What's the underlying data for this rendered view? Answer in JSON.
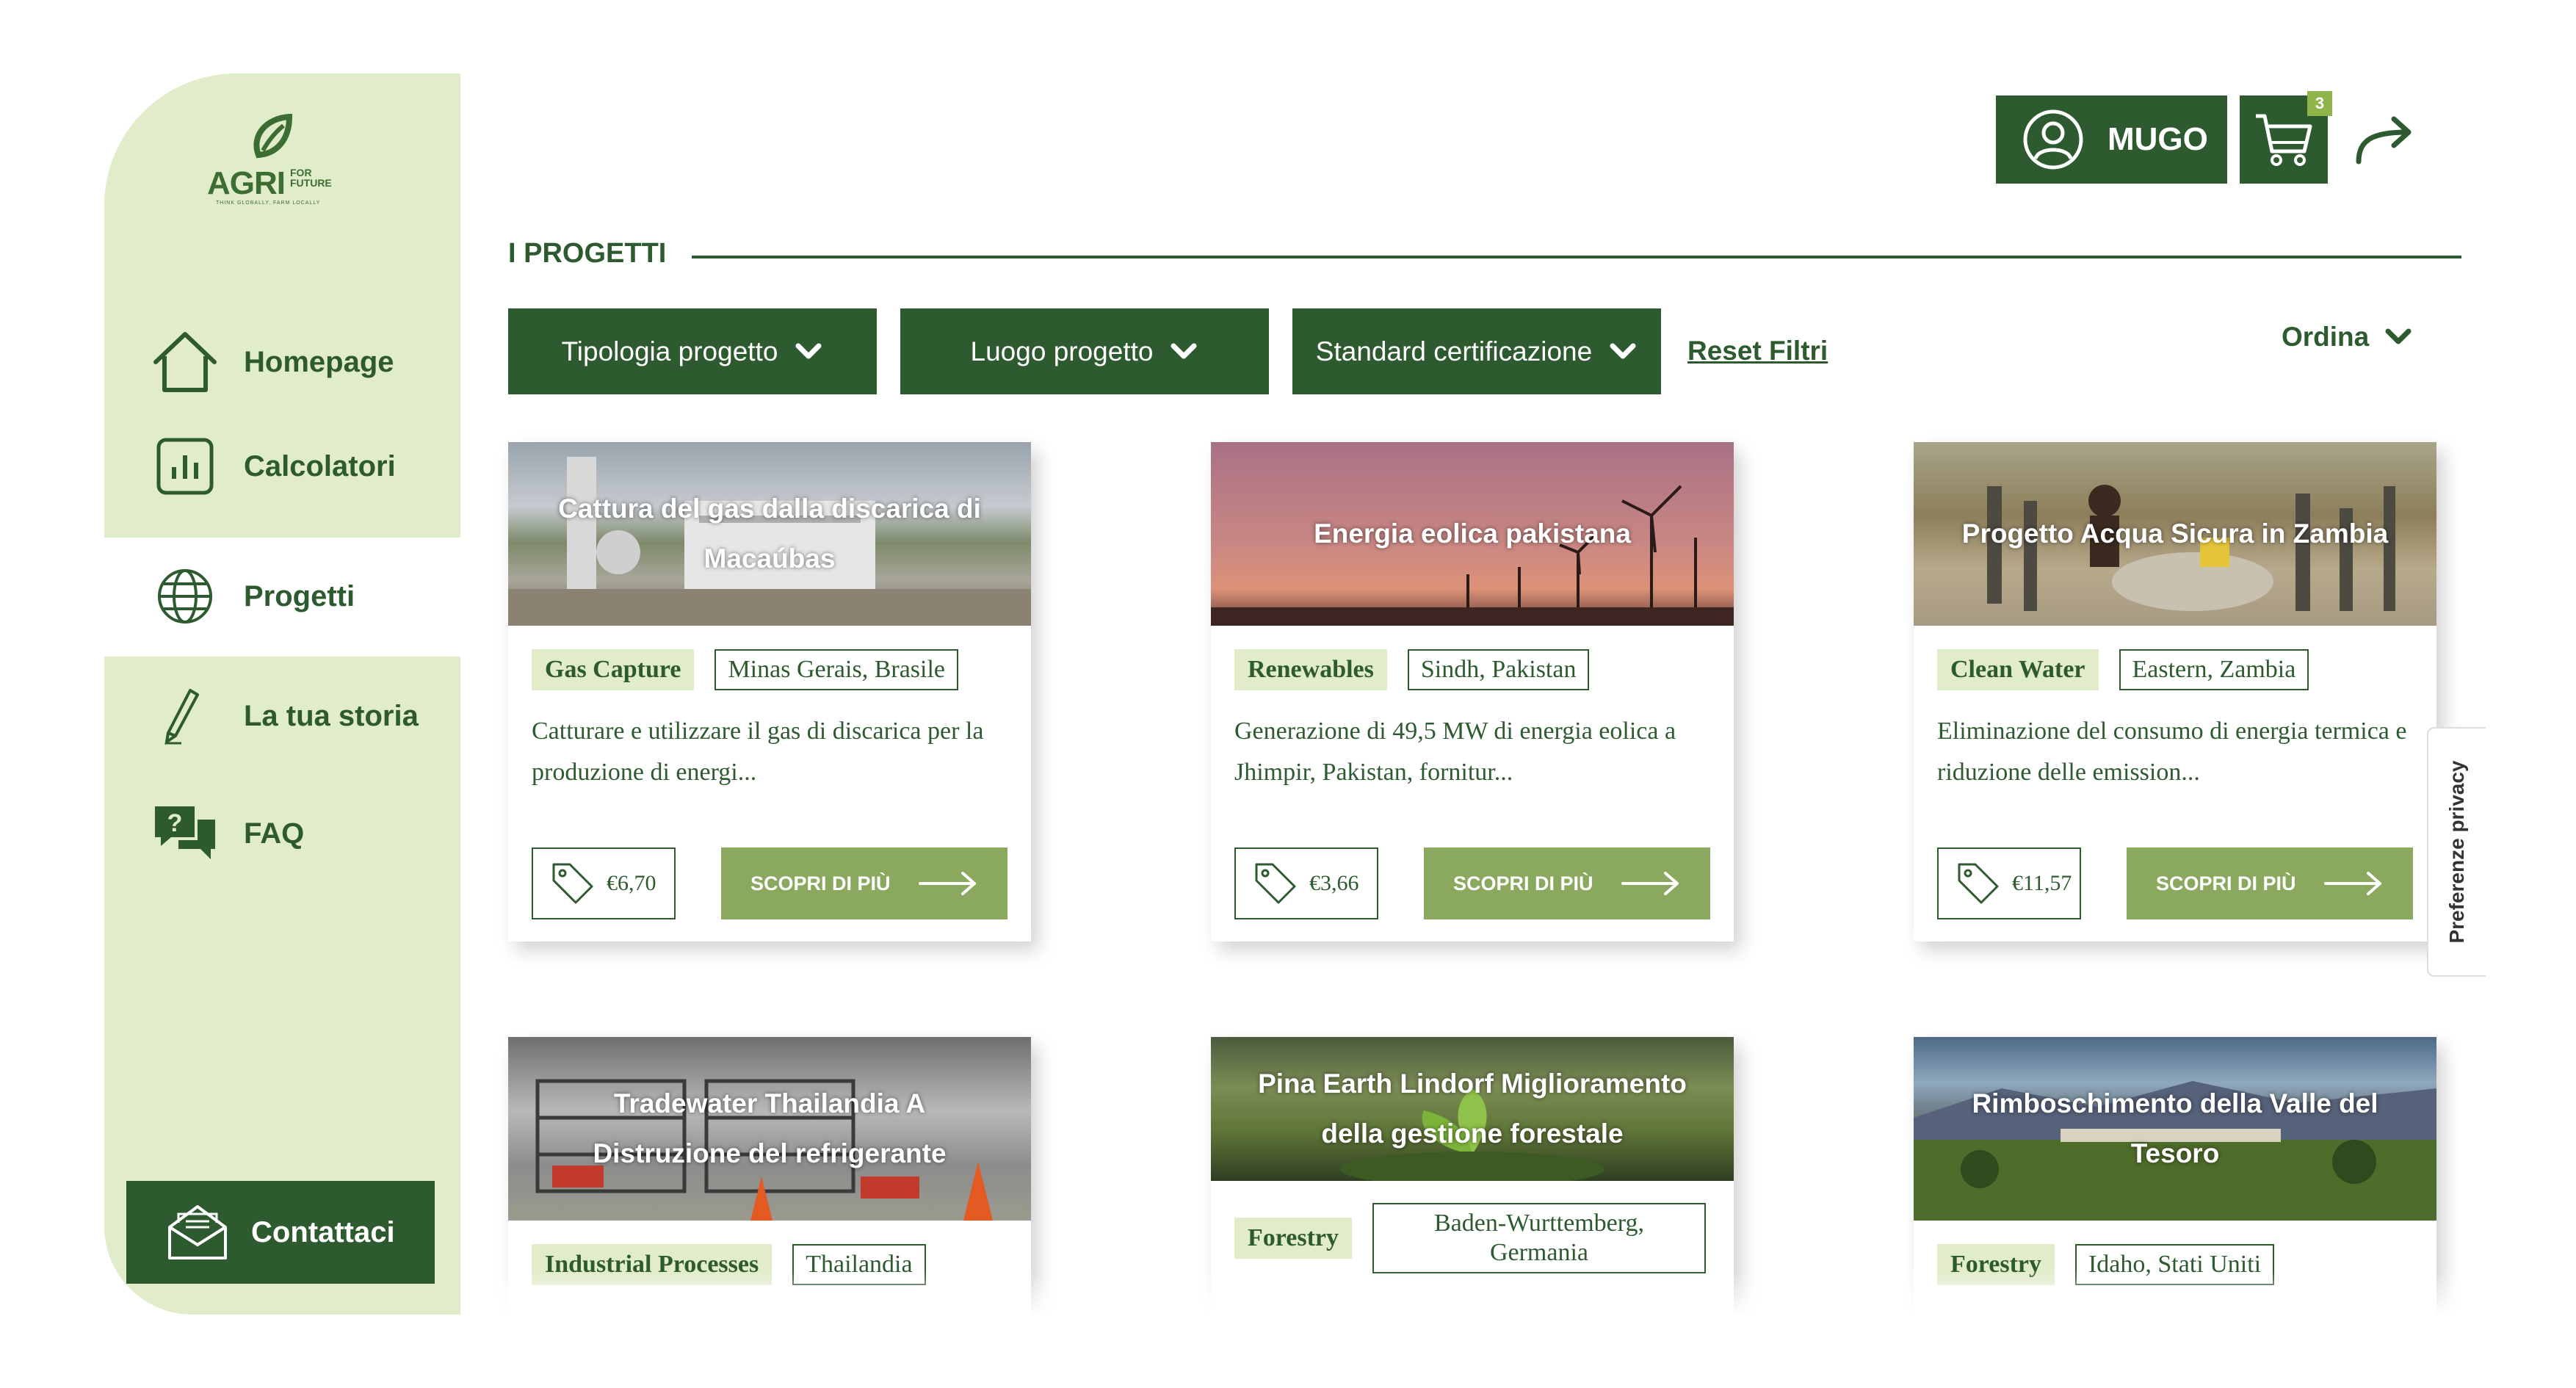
{
  "brand": {
    "name": "AGRI",
    "suffix_top": "FOR",
    "suffix_bottom": "FUTURE",
    "tagline": "THINK GLOBALLY, FARM LOCALLY",
    "color": "#2e5a30",
    "accent": "#8ba85f",
    "sidebar_bg": "#e1ecca"
  },
  "sidebar": {
    "items": [
      {
        "label": "Homepage",
        "icon": "home-icon"
      },
      {
        "label": "Calcolatori",
        "icon": "chart-icon"
      },
      {
        "label": "Progetti",
        "icon": "globe-icon",
        "active": true
      },
      {
        "label": "La tua storia",
        "icon": "pen-icon"
      },
      {
        "label": "FAQ",
        "icon": "chat-question-icon"
      }
    ],
    "contact_label": "Contattaci"
  },
  "header": {
    "user_name": "MUGO",
    "cart_count": "3"
  },
  "section": {
    "title": "I PROGETTI"
  },
  "filters": {
    "type": "Tipologia progetto",
    "place": "Luogo progetto",
    "standard": "Standard certificazione",
    "reset": "Reset Filtri",
    "sort": "Ordina"
  },
  "projects": [
    {
      "title": "Cattura del gas dalla discarica di Macaúbas",
      "category": "Gas Capture",
      "location": "Minas Gerais, Brasile",
      "description": "Catturare e utilizzare il gas di discarica per la produzione di energi...",
      "price": "€6,70",
      "cta": "SCOPRI DI PIÙ"
    },
    {
      "title": "Energia eolica pakistana",
      "category": "Renewables",
      "location": "Sindh, Pakistan",
      "description": "Generazione di 49,5 MW di energia eolica a Jhimpir, Pakistan, fornitur...",
      "price": "€3,66",
      "cta": "SCOPRI DI PIÙ"
    },
    {
      "title": "Progetto Acqua Sicura in Zambia",
      "category": "Clean Water",
      "location": "Eastern, Zambia",
      "description": "Eliminazione del consumo di energia termica e riduzione delle emission...",
      "price": "€11,57",
      "cta": "SCOPRI DI PIÙ"
    },
    {
      "title": "Tradewater Thailandia A Distruzione del refrigerante",
      "category": "Industrial Processes",
      "location": "Thailandia"
    },
    {
      "title": "Pina Earth Lindorf Miglioramento della gestione forestale",
      "category": "Forestry",
      "location": "Baden-Wurttemberg, Germania"
    },
    {
      "title": "Rimboschimento della Valle del Tesoro",
      "category": "Forestry",
      "location": "Idaho, Stati Uniti"
    }
  ],
  "privacy": {
    "label": "Preferenze privacy"
  }
}
